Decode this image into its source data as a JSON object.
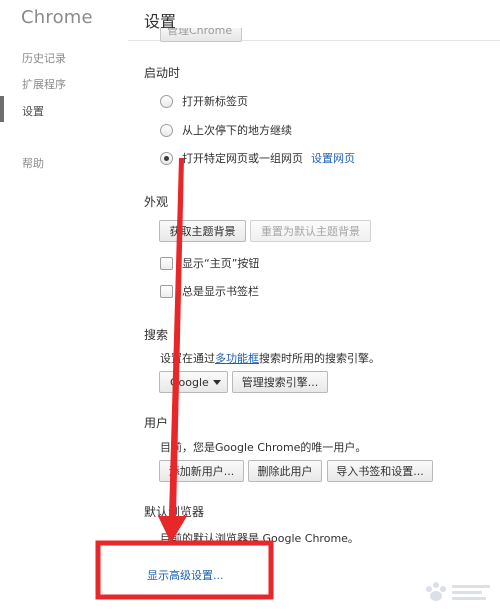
{
  "sidebar": {
    "brand": "Chrome",
    "items": [
      {
        "label": "历史记录"
      },
      {
        "label": "扩展程序"
      },
      {
        "label": "设置"
      },
      {
        "label": "帮助"
      }
    ]
  },
  "header": {
    "title": "设置",
    "clipped_button": "管理Chrome"
  },
  "startup": {
    "title": "启动时",
    "options": [
      {
        "label": "打开新标签页",
        "checked": false
      },
      {
        "label": "从上次停下的地方继续",
        "checked": false
      },
      {
        "label": "打开特定网页或一组网页",
        "checked": true
      }
    ],
    "set_pages_link": "设置网页"
  },
  "appearance": {
    "title": "外观",
    "get_theme_button": "获取主题背景",
    "reset_theme_button": "重置为默认主题背景",
    "show_home_checkbox": "显示“主页”按钮",
    "show_bookmarks_checkbox": "总是显示书签栏"
  },
  "search": {
    "title": "搜索",
    "desc_prefix": "设置在通过",
    "desc_link": "多功能框",
    "desc_suffix": "搜索时所用的搜索引擎。",
    "engine_selected": "Google",
    "manage_button": "管理搜索引擎..."
  },
  "users": {
    "title": "用户",
    "desc": "目前，您是Google Chrome的唯一用户。",
    "add_button": "添加新用户...",
    "delete_button": "删除此用户",
    "import_button": "导入书签和设置..."
  },
  "default_browser": {
    "title": "默认浏览器",
    "desc": "目前的默认浏览器是 Google Chrome。"
  },
  "advanced_link": "显示高级设置...",
  "annotation_color": "#e8272a"
}
